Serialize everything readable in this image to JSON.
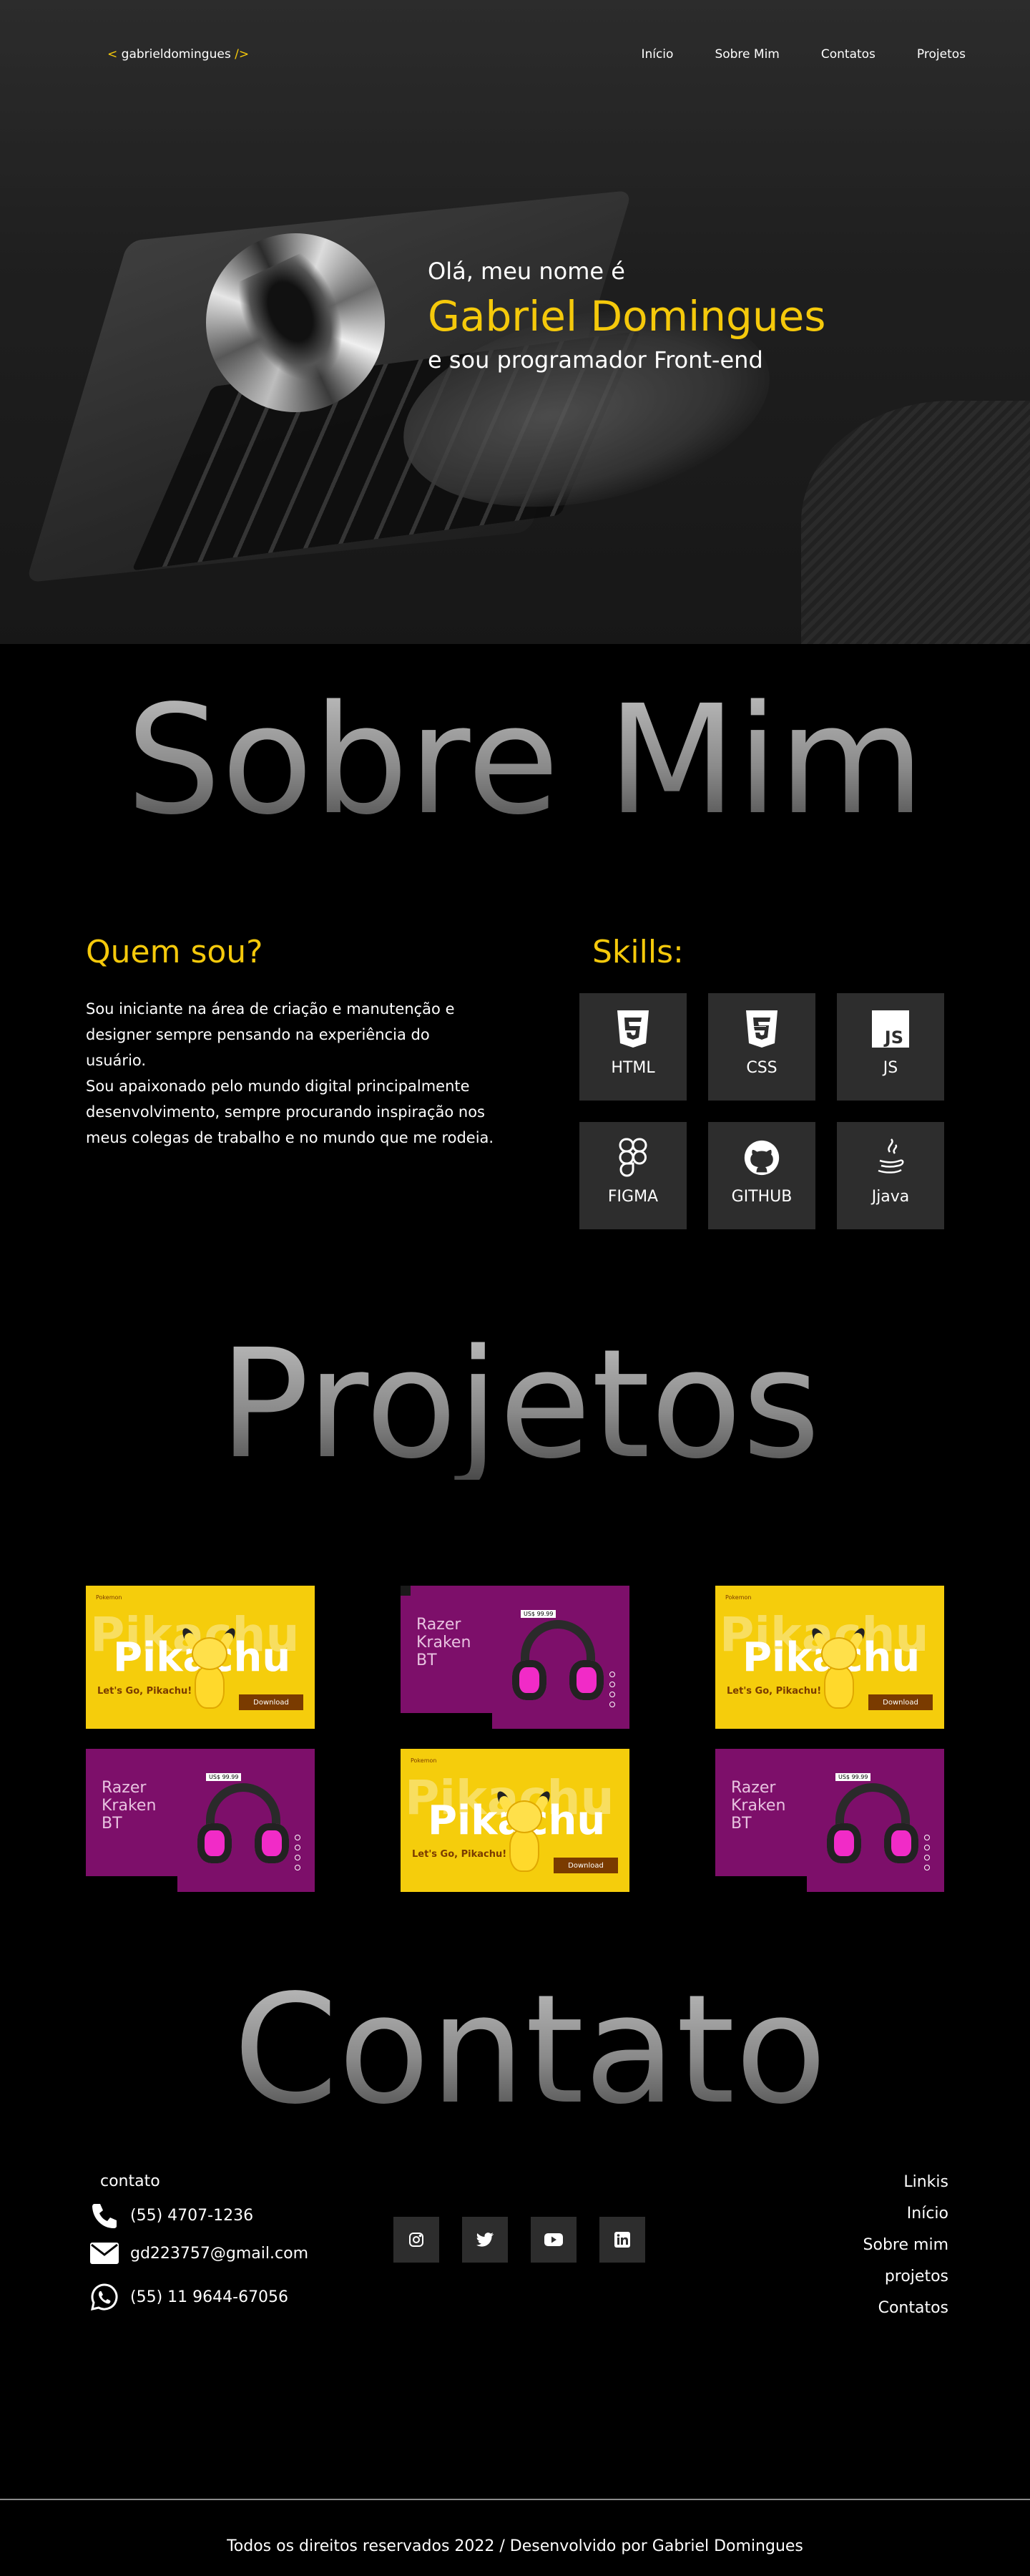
{
  "nav": {
    "logo_open": "<",
    "logo_text": "gabrieldomingues",
    "logo_close": "/>",
    "links": [
      "Início",
      "Sobre Mim",
      "Contatos",
      "Projetos"
    ]
  },
  "hero": {
    "greeting": "Olá, meu nome é",
    "name": "Gabriel Domingues",
    "role": "e sou programador Front-end"
  },
  "about": {
    "title": "Sobre Mim",
    "who_heading": "Quem sou?",
    "who_lines": [
      "Sou iniciante na área de criação e manutenção e",
      "designer sempre pensando na experiência do",
      "usuário.",
      "Sou apaixonado  pelo mundo digital principalmente",
      "desenvolvimento,  sempre procurando inspiração nos",
      "meus colegas de trabalho e no mundo que me rodeia."
    ],
    "skills_heading": "Skills:",
    "skills": [
      {
        "label": "HTML",
        "icon": "html5-icon"
      },
      {
        "label": "CSS",
        "icon": "css3-icon"
      },
      {
        "label": "JS",
        "icon": "javascript-icon"
      },
      {
        "label": "FIGMA",
        "icon": "figma-icon"
      },
      {
        "label": "GITHUB",
        "icon": "github-icon"
      },
      {
        "label": "Jjava",
        "icon": "java-icon"
      }
    ]
  },
  "projects": {
    "title": "Projetos",
    "pika": {
      "brand": "Pokemon",
      "bg_word": "Pikachu",
      "title": "Pikachu",
      "subtitle": "Let's Go, Pikachu!",
      "button": "Download"
    },
    "razer": {
      "title_lines": [
        "Razer",
        "Kraken",
        "BT"
      ],
      "tag": "US$ 99.99"
    }
  },
  "contact": {
    "title": "Contato",
    "heading": "contato",
    "phone": "(55) 4707-1236",
    "email": "gd223757@gmail.com",
    "whatsapp": "(55) 11 9644-67056",
    "social": [
      "instagram-icon",
      "twitter-icon",
      "youtube-icon",
      "linkedin-icon"
    ],
    "links_heading": "Linkis",
    "links": [
      "Início",
      "Sobre mim",
      "projetos",
      "Contatos"
    ]
  },
  "footer": {
    "text": "Todos os direitos reservados 2022 / Desenvolvido por Gabriel Domingues"
  },
  "colors": {
    "accent": "#f5c90b",
    "tile": "#2d2d2d",
    "pika_bg": "#f5cd0c",
    "razer_bg": "#7d0f6a"
  }
}
